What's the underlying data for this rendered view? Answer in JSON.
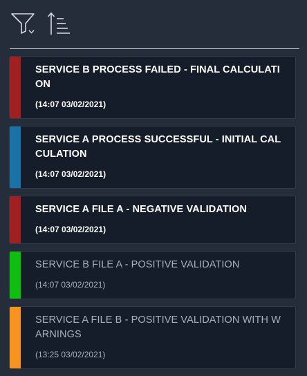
{
  "toolbar": {
    "filter_icon": "filter-icon",
    "sort_icon": "sort-ascending-icon"
  },
  "status_colors": {
    "error": "#a01f20",
    "info": "#1a73a8",
    "success": "#0fbf0f",
    "warning": "#f7931e"
  },
  "notifications": [
    {
      "title": "SERVICE B PROCESS FAILED - FINAL CALCULATION",
      "time": "(14:07 03/02/2021)",
      "status": "error",
      "read": false
    },
    {
      "title": "SERVICE A PROCESS SUCCESSFUL - INITIAL CALCULATION",
      "time": "(14:07 03/02/2021)",
      "status": "info",
      "read": false
    },
    {
      "title": "SERVICE A FILE A - NEGATIVE VALIDATION",
      "time": "(14:07 03/02/2021)",
      "status": "error",
      "read": false
    },
    {
      "title": "SERVICE B FILE A - POSITIVE VALIDATION",
      "time": "(14:07 03/02/2021)",
      "status": "success",
      "read": true
    },
    {
      "title": "SERVICE A FILE B - POSITIVE VALIDATION WITH WARNINGS",
      "time": "(13:25 03/02/2021)",
      "status": "warning",
      "read": true
    }
  ]
}
